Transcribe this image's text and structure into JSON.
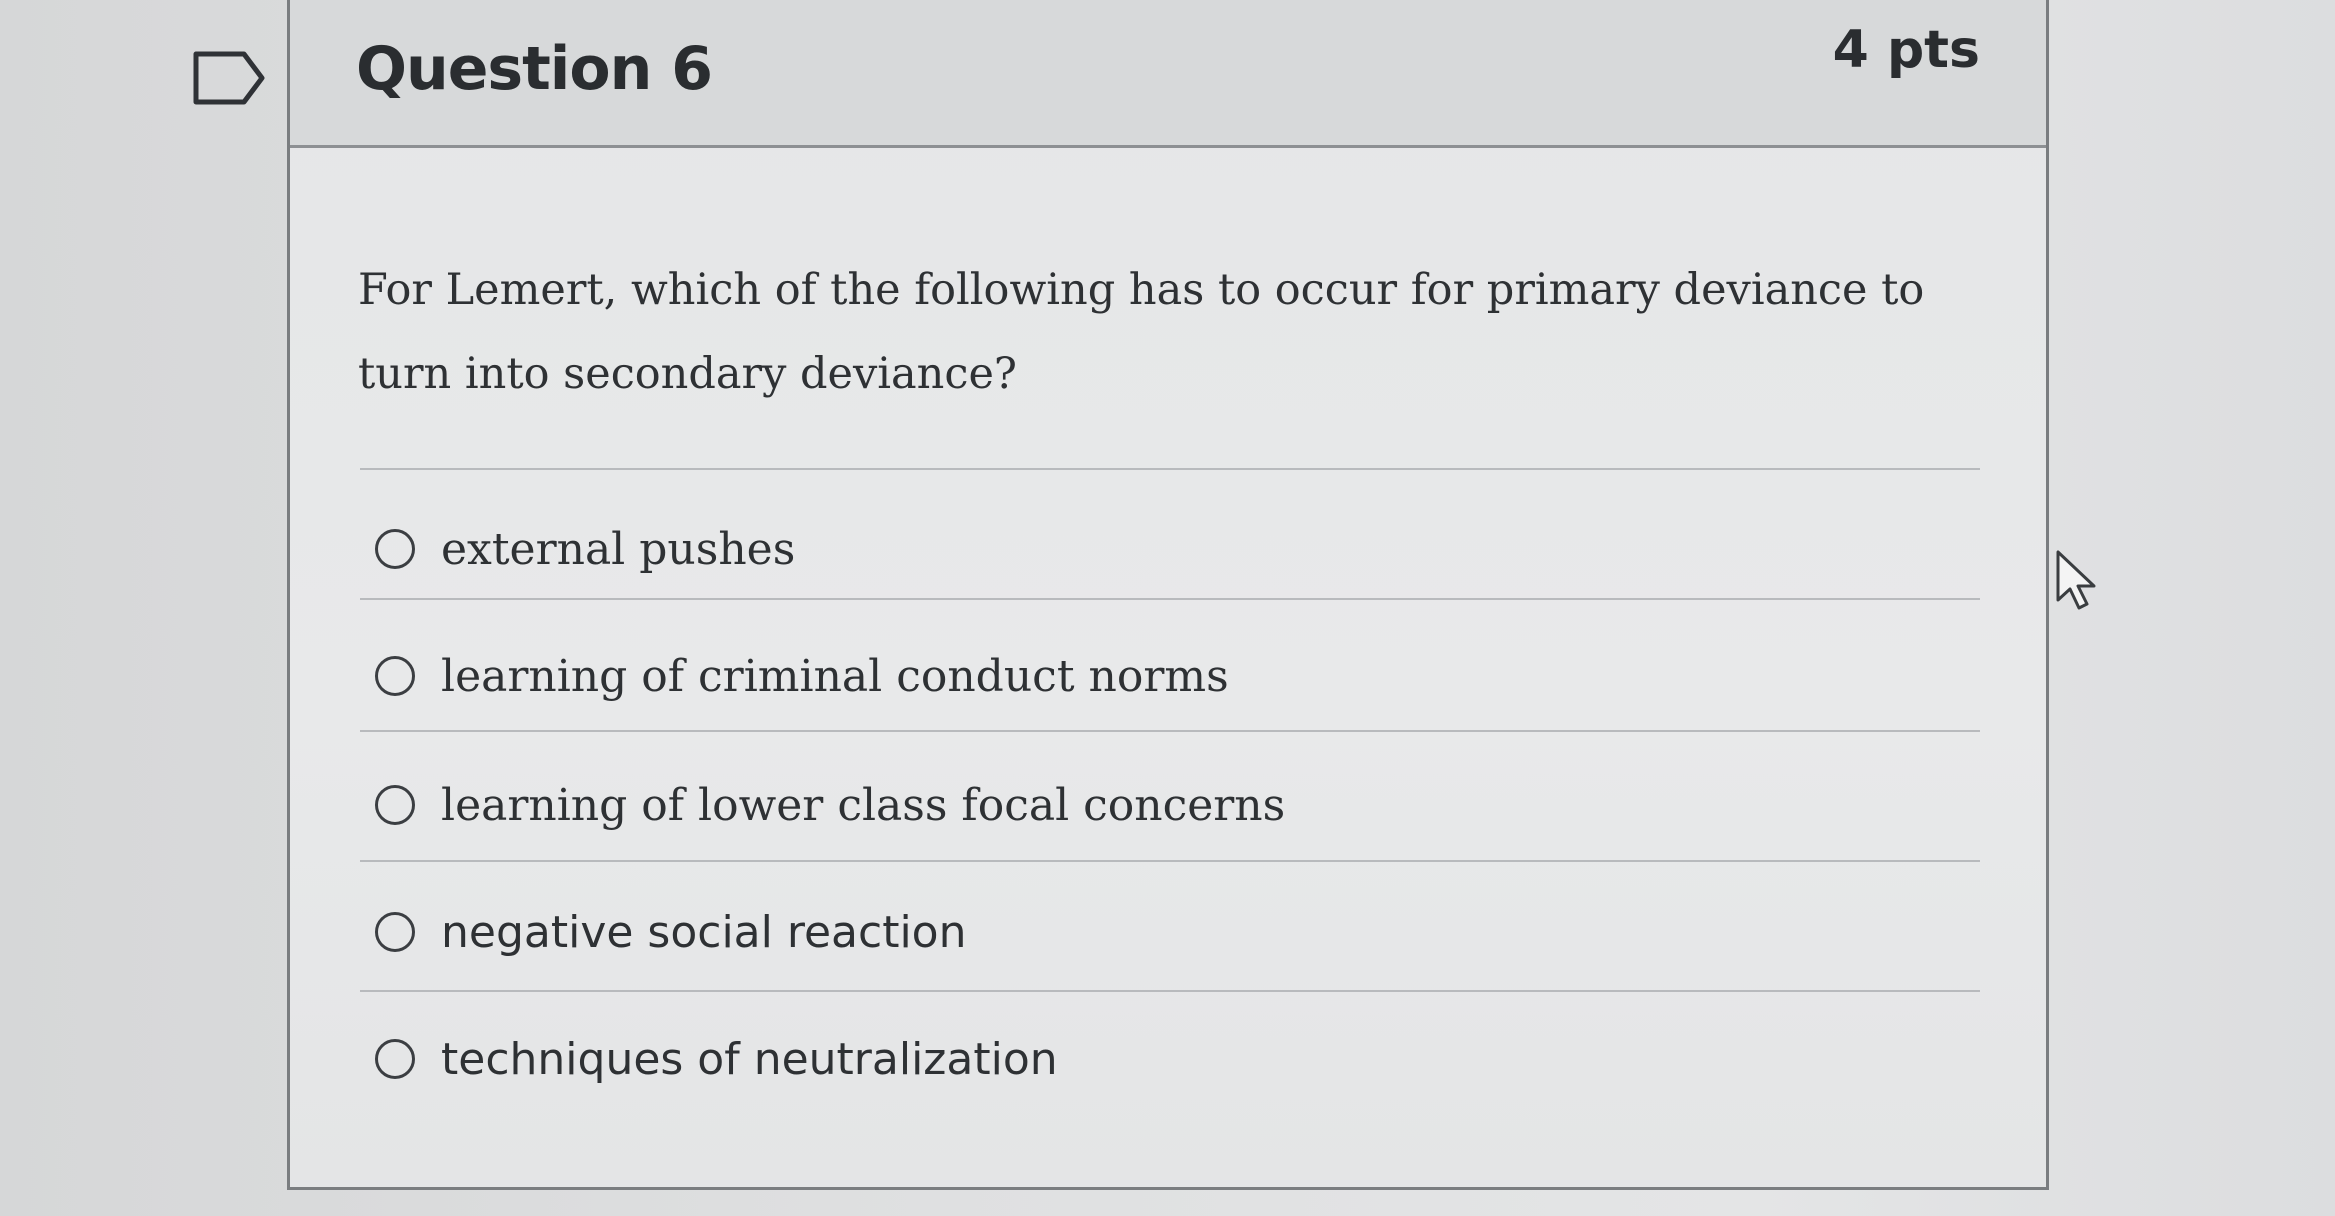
{
  "question": {
    "title": "Question 6",
    "points": "4 pts",
    "text": "For Lemert, which of the following has to occur for primary deviance to turn into secondary deviance?"
  },
  "answers": [
    {
      "label": "external pushes",
      "selected": false
    },
    {
      "label": "learning of criminal conduct norms",
      "selected": false
    },
    {
      "label": "learning of lower class focal concerns",
      "selected": false
    },
    {
      "label": "negative social reaction",
      "selected": false
    },
    {
      "label": "techniques of neutralization",
      "selected": false
    }
  ],
  "icons": {
    "flag": "flag-question-icon",
    "cursor": "mouse-pointer-icon"
  },
  "colors": {
    "border": "#7a7d80",
    "header_bg": "#d7d9da",
    "text": "#2e3134"
  }
}
